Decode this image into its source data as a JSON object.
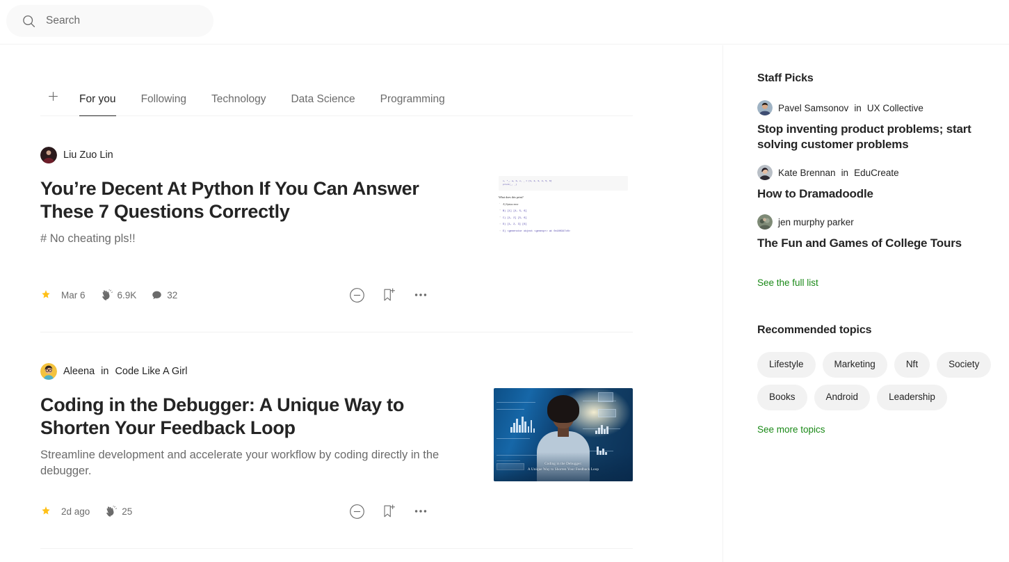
{
  "search": {
    "placeholder": "Search",
    "value": "",
    "icon": "search-icon"
  },
  "tabs": {
    "add_icon": "plus-icon",
    "items": [
      {
        "label": "For you",
        "active": true
      },
      {
        "label": "Following",
        "active": false
      },
      {
        "label": "Technology",
        "active": false
      },
      {
        "label": "Data Science",
        "active": false
      },
      {
        "label": "Programming",
        "active": false
      }
    ]
  },
  "feed": {
    "articles": [
      {
        "author": "Liu Zuo Lin",
        "publication": "",
        "in_word": "",
        "title": "You’re Decent At Python If You Can Answer These 7 Questions Correctly",
        "subtitle": "# No cheating pls!!",
        "date": "Mar 6",
        "claps": "6.9K",
        "comments": "32",
        "star_icon": "star-icon",
        "clap_icon": "clap-icon",
        "comment_icon": "comment-icon",
        "mute_icon": "minus-circle-icon",
        "save_icon": "bookmark-plus-icon",
        "more_icon": "ellipsis-icon",
        "thumbnail": {
          "kind": "quiz-screenshot",
          "code_line_1": "x, *_, a, b, c, _ = [1, 2, 3, 4, 5, 6]",
          "code_line_2": "print(_, _)",
          "question": "What does this print?",
          "options": [
            "A) Syntax error",
            "B) [1] [4, 5, 6]",
            "C) [1, 2] [5, 6]",
            "D) [1, 2, 3] [6]",
            "E) <generator object <genexpr> at 0x100347c0>"
          ]
        }
      },
      {
        "author": "Aleena",
        "publication": "Code Like A Girl",
        "in_word": "in",
        "title": "Coding in the Debugger: A Unique Way to Shorten Your Feedback Loop",
        "subtitle": "Streamline development and accelerate your workflow by coding directly in the debugger.",
        "date": "2d ago",
        "claps": "25",
        "comments": "",
        "star_icon": "star-icon",
        "clap_icon": "clap-icon",
        "comment_icon": "comment-icon",
        "mute_icon": "minus-circle-icon",
        "save_icon": "bookmark-plus-icon",
        "more_icon": "ellipsis-icon",
        "thumbnail": {
          "kind": "debugger-hero",
          "caption_line_1": "Coding in the Debugger:",
          "caption_line_2": "A Unique Way to Shorten Your Feedback Loop"
        }
      }
    ]
  },
  "sidebar": {
    "staff_picks": {
      "heading": "Staff Picks",
      "items": [
        {
          "author": "Pavel Samsonov",
          "in_word": "in",
          "publication": "UX Collective",
          "title": "Stop inventing product problems; start solving customer problems"
        },
        {
          "author": "Kate Brennan",
          "in_word": "in",
          "publication": "EduCreate",
          "title": "How to Dramadoodle"
        },
        {
          "author": "jen murphy parker",
          "in_word": "",
          "publication": "",
          "title": "The Fun and Games of College Tours"
        }
      ],
      "see_all": "See the full list"
    },
    "topics": {
      "heading": "Recommended topics",
      "items": [
        "Lifestyle",
        "Marketing",
        "Nft",
        "Society",
        "Books",
        "Android",
        "Leadership"
      ],
      "see_more": "See more topics"
    }
  },
  "colors": {
    "accent_green": "#1a8917",
    "star_yellow": "#ffc017",
    "text_primary": "#242424",
    "text_muted": "#6b6b6b",
    "pill_bg": "#f2f2f2"
  }
}
